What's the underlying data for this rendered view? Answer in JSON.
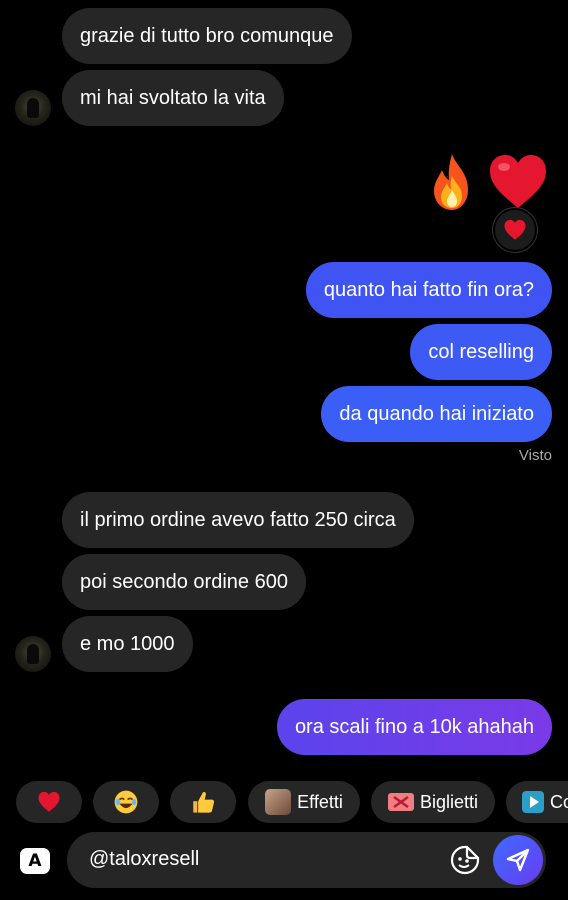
{
  "messages": {
    "m1": "grazie di tutto bro comunque",
    "m2": "mi hai svoltato la vita",
    "m3": "quanto hai fatto fin ora?",
    "m4": "col reselling",
    "m5": "da quando hai iniziato",
    "seen": "Visto",
    "m6": "il primo ordine avevo fatto 250 circa",
    "m7": "poi secondo ordine 600",
    "m8": "e mo 1000",
    "m9": "ora scali fino a 10k ahahah"
  },
  "emoji_message": {
    "emojis": [
      "fire-emoji",
      "red-heart-emoji"
    ],
    "reaction": "red-heart-emoji"
  },
  "quick_replies": {
    "effects_label": "Effetti",
    "tickets_label": "Biglietti",
    "partial_label": "Co"
  },
  "composer": {
    "value": "@taloxresell",
    "keyboard_label": "A"
  },
  "colors": {
    "received_bubble": "#262626",
    "sent_gradient_top": "#3d5bf5",
    "sent_gradient_bottom": "#7a3ae8",
    "background": "#000000",
    "accent_send": "#3d6bff"
  }
}
